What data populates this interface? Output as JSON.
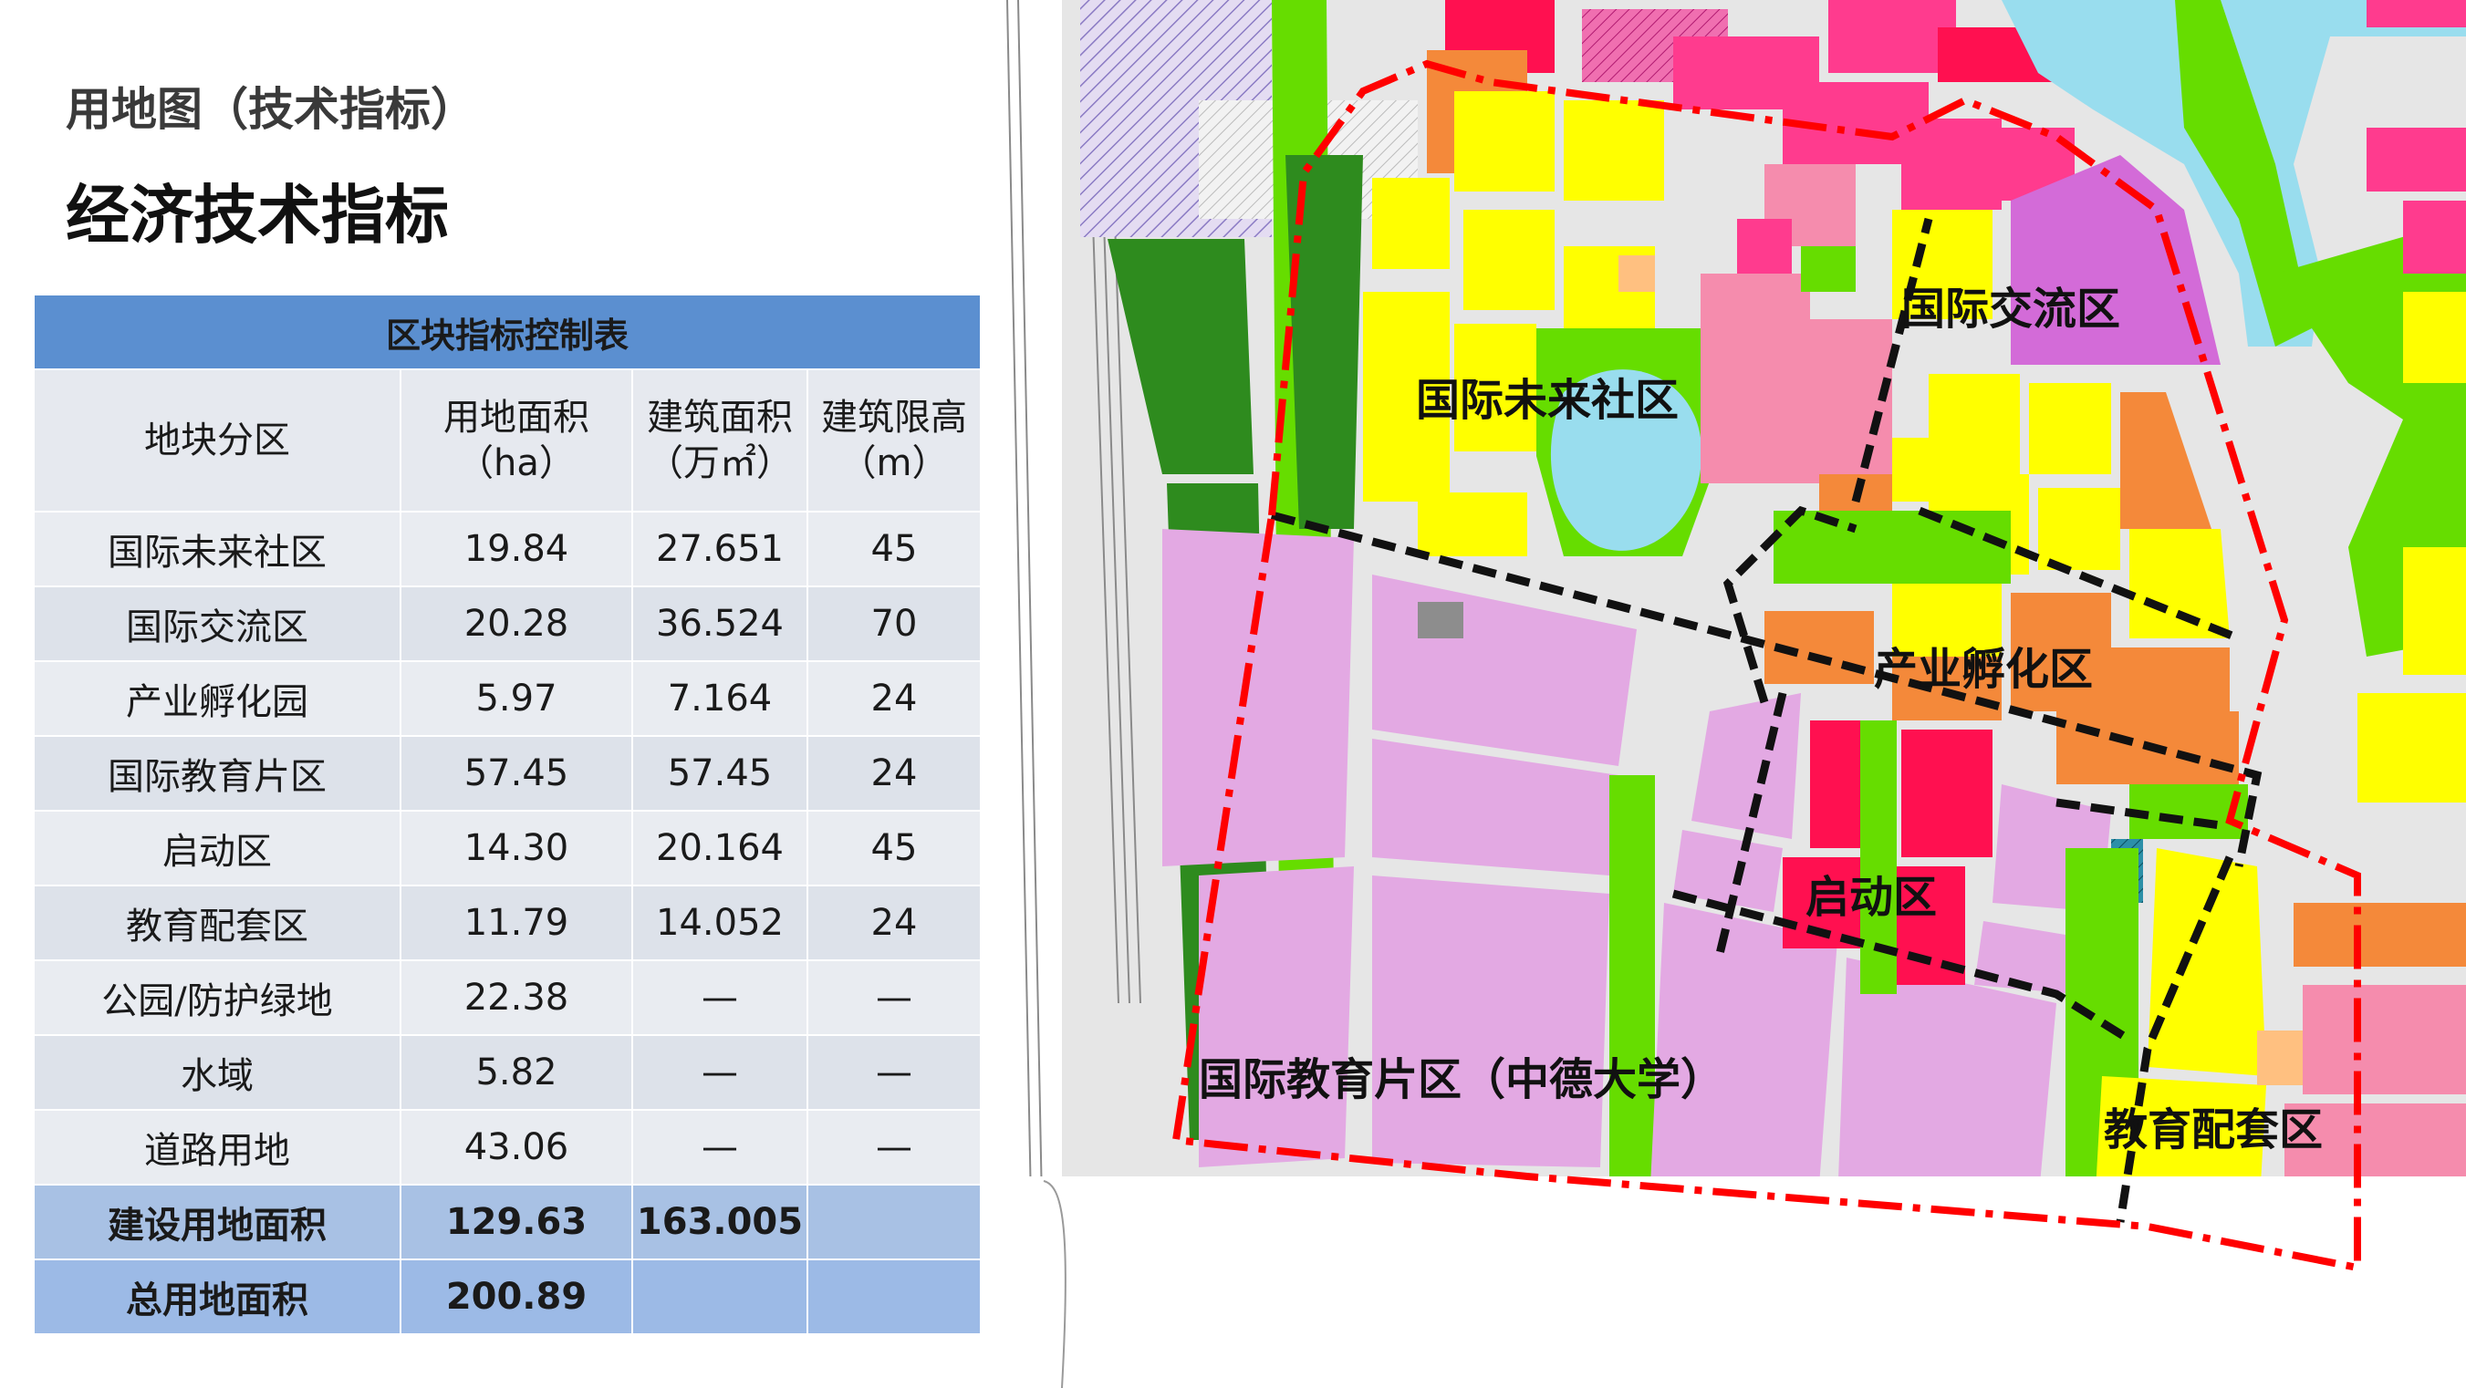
{
  "header": {
    "subtitle": "用地图（技术指标）",
    "title": "经济技术指标"
  },
  "table": {
    "caption": "区块指标控制表",
    "columns": [
      {
        "name": "地块分区",
        "unit": ""
      },
      {
        "name": "用地面积",
        "unit": "（ha）"
      },
      {
        "name": "建筑面积",
        "unit": "（万㎡）"
      },
      {
        "name": "建筑限高",
        "unit": "（m）"
      }
    ],
    "rows": [
      [
        "国际未来社区",
        "19.84",
        "27.651",
        "45"
      ],
      [
        "国际交流区",
        "20.28",
        "36.524",
        "70"
      ],
      [
        "产业孵化园",
        "5.97",
        "7.164",
        "24"
      ],
      [
        "国际教育片区",
        "57.45",
        "57.45",
        "24"
      ],
      [
        "启动区",
        "14.30",
        "20.164",
        "45"
      ],
      [
        "教育配套区",
        "11.79",
        "14.052",
        "24"
      ],
      [
        "公园/防护绿地",
        "22.38",
        "—",
        "—"
      ],
      [
        "水域",
        "5.82",
        "—",
        "—"
      ],
      [
        "道路用地",
        "43.06",
        "—",
        "—"
      ]
    ],
    "summary": [
      [
        "建设用地面积",
        "129.63",
        "163.005",
        ""
      ],
      [
        "总用地面积",
        "200.89",
        "",
        ""
      ]
    ]
  },
  "map": {
    "labels": {
      "future_community": "国际未来社区",
      "exchange": "国际交流区",
      "incubation": "产业孵化区",
      "startup": "启动区",
      "education": "国际教育片区（中德大学）",
      "edu_support": "教育配套区"
    },
    "colors": {
      "residential": "#ffff00",
      "commercial": "#ff3b8e",
      "education": "#e3a9e3",
      "green": "#66dd00",
      "dark_green": "#2e8b1e",
      "water": "#99ddee",
      "orange": "#f4893a",
      "red": "#ff1050",
      "salmon": "#f58cad",
      "violet": "#d36bd8",
      "boundary": "#ff0000"
    }
  }
}
